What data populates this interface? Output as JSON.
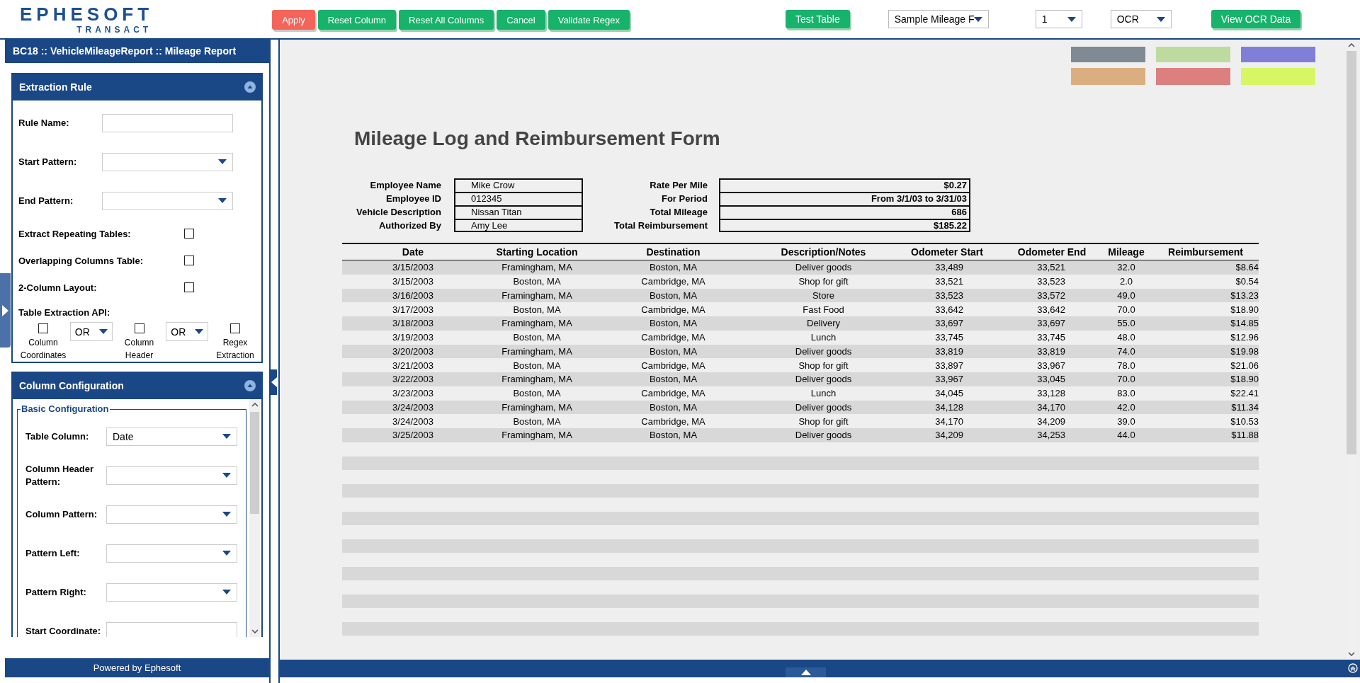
{
  "logo": {
    "brand": "EPHESOFT",
    "product": "TRANSACT"
  },
  "toolbar": [
    {
      "label": "Apply",
      "kind": "danger"
    },
    {
      "label": "Reset Column",
      "kind": "primary"
    },
    {
      "label": "Reset All Columns",
      "kind": "primary"
    },
    {
      "label": "Cancel",
      "kind": "primary"
    },
    {
      "label": "Validate Regex",
      "kind": "primary"
    }
  ],
  "test_button": "Test Table",
  "selects": [
    {
      "value": "Sample Mileage F",
      "kind": "wide"
    },
    {
      "value": "1",
      "kind": "narrow"
    },
    {
      "value": "OCR",
      "kind": "narrow"
    }
  ],
  "view_button": "View OCR Data",
  "breadcrumb": "BC18 :: VehicleMileageReport :: Mileage Report",
  "extraction_rule": {
    "title": "Extraction Rule",
    "fields": [
      {
        "label": "Rule Name:",
        "kind": "text"
      },
      {
        "label": "Start Pattern:",
        "kind": "select"
      },
      {
        "label": "End Pattern:",
        "kind": "select"
      },
      {
        "label": "Extract Repeating Tables:",
        "kind": "checkbox",
        "checked": false
      },
      {
        "label": "Overlapping Columns Table:",
        "kind": "checkbox",
        "checked": false
      },
      {
        "label": "2-Column Layout:",
        "kind": "checkbox",
        "checked": false
      }
    ],
    "api_label": "Table Extraction API:",
    "api_options": [
      {
        "kind": "checkbox",
        "label": "Column Coordinates",
        "checked": false
      },
      {
        "kind": "operator",
        "value": "OR"
      },
      {
        "kind": "checkbox",
        "label": "Column Header",
        "checked": false
      },
      {
        "kind": "operator",
        "value": "OR"
      },
      {
        "kind": "checkbox",
        "label": "Regex Extraction",
        "checked": false
      }
    ]
  },
  "column_configuration": {
    "title": "Column Configuration",
    "group": "Basic Configuration",
    "fields": [
      {
        "label": "Table Column:",
        "kind": "select",
        "value": "Date"
      },
      {
        "label": "Column Header Pattern:",
        "kind": "select"
      },
      {
        "label": "Column Pattern:",
        "kind": "select"
      },
      {
        "label": "Pattern Left:",
        "kind": "select"
      },
      {
        "label": "Pattern Right:",
        "kind": "select"
      },
      {
        "label": "Start Coordinate:",
        "kind": "text"
      }
    ]
  },
  "footer": "Powered by Ephesoft",
  "color_legend": [
    {
      "color": "#7f8a94"
    },
    {
      "color": "#bddb9f"
    },
    {
      "color": "#7f7fd8"
    },
    {
      "color": "#dbae7f"
    },
    {
      "color": "#db7f7f"
    },
    {
      "color": "#d6f763"
    }
  ],
  "document": {
    "title": "Mileage Log and Reimbursement Form",
    "info_left": [
      {
        "label": "Employee Name",
        "value": "Mike Crow"
      },
      {
        "label": "Employee ID",
        "value": "012345"
      },
      {
        "label": "Vehicle Description",
        "value": "Nissan Titan"
      },
      {
        "label": "Authorized By",
        "value": "Amy Lee"
      }
    ],
    "info_right": [
      {
        "label": "Rate Per Mile",
        "value": "$0.27"
      },
      {
        "label": "For Period",
        "value": "From 3/1/03 to 3/31/03"
      },
      {
        "label": "Total Mileage",
        "value": "686"
      },
      {
        "label": "Total Reimbursement",
        "value": "$185.22"
      }
    ],
    "columns": [
      "Date",
      "Starting Location",
      "Destination",
      "Description/Notes",
      "Odometer Start",
      "Odometer End",
      "Mileage",
      "Reimbursement"
    ],
    "rows": [
      [
        "3/15/2003",
        "Framingham, MA",
        "Boston, MA",
        "Deliver goods",
        "33,489",
        "33,521",
        "32.0",
        "$8.64"
      ],
      [
        "3/15/2003",
        "Boston, MA",
        "Cambridge, MA",
        "Shop for gift",
        "33,521",
        "33,523",
        "2.0",
        "$0.54"
      ],
      [
        "3/16/2003",
        "Framingham, MA",
        "Boston, MA",
        "Store",
        "33,523",
        "33,572",
        "49.0",
        "$13.23"
      ],
      [
        "3/17/2003",
        "Boston, MA",
        "Cambridge, MA",
        "Fast Food",
        "33,642",
        "33,642",
        "70.0",
        "$18.90"
      ],
      [
        "3/18/2003",
        "Framingham, MA",
        "Boston, MA",
        "Delivery",
        "33,697",
        "33,697",
        "55.0",
        "$14.85"
      ],
      [
        "3/19/2003",
        "Boston, MA",
        "Cambridge, MA",
        "Lunch",
        "33,745",
        "33,745",
        "48.0",
        "$12.96"
      ],
      [
        "3/20/2003",
        "Framingham, MA",
        "Boston, MA",
        "Deliver goods",
        "33,819",
        "33,819",
        "74.0",
        "$19.98"
      ],
      [
        "3/21/2003",
        "Boston, MA",
        "Cambridge, MA",
        "Shop for gift",
        "33,897",
        "33,967",
        "78.0",
        "$21.06"
      ],
      [
        "3/22/2003",
        "Framingham, MA",
        "Boston, MA",
        "Deliver goods",
        "33,967",
        "33,045",
        "70.0",
        "$18.90"
      ],
      [
        "3/23/2003",
        "Boston, MA",
        "Cambridge, MA",
        "Lunch",
        "34,045",
        "33,128",
        "83.0",
        "$22.41"
      ],
      [
        "3/24/2003",
        "Framingham, MA",
        "Boston, MA",
        "Deliver goods",
        "34,128",
        "34,170",
        "42.0",
        "$11.34"
      ],
      [
        "3/24/2003",
        "Boston, MA",
        "Cambridge, MA",
        "Shop for gift",
        "34,170",
        "34,209",
        "39.0",
        "$10.53"
      ],
      [
        "3/25/2003",
        "Framingham, MA",
        "Boston, MA",
        "Deliver goods",
        "34,209",
        "34,253",
        "44.0",
        "$11.88"
      ]
    ]
  }
}
